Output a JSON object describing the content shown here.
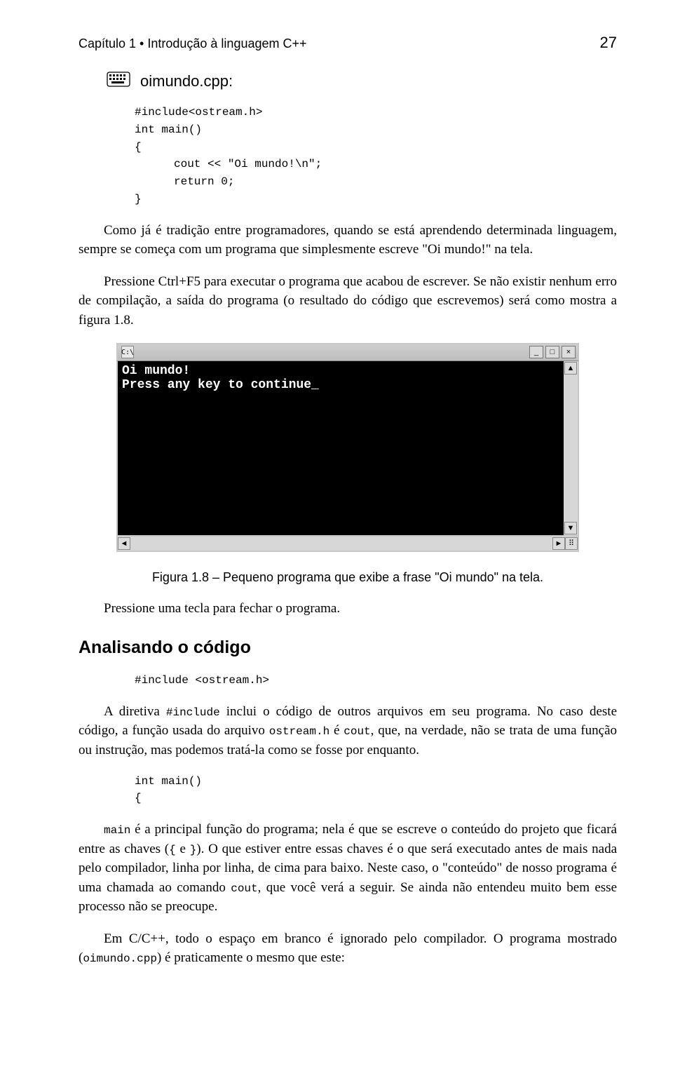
{
  "header": {
    "chapter": "Capítulo 1 • Introdução à linguagem C++",
    "pageNumber": "27"
  },
  "file": {
    "icon": "keyboard-icon",
    "name": "oimundo.cpp:"
  },
  "code1": {
    "l1": "#include<ostream.h>",
    "l2": "int main()",
    "l3": "{",
    "l4": "cout << \"Oi mundo!\\n\";",
    "l5": "return 0;",
    "l6": "}"
  },
  "para1": "Como já é tradição entre programadores, quando se está aprendendo determinada linguagem, sempre se começa com um programa que simplesmente escreve \"Oi mundo!\" na tela.",
  "para2": "Pressione Ctrl+F5 para executar o programa que acabou de escrever. Se não existir nenhum erro de compilação, a saída do programa (o resultado do código que escrevemos) será como mostra a figura 1.8.",
  "console": {
    "titleIcon": "C:\\",
    "minimize": "_",
    "maximize": "□",
    "close": "×",
    "line1": "Oi mundo!",
    "line2": "Press any key to continue_",
    "scrollUp": "▲",
    "scrollDown": "▼",
    "scrollLeft": "◄",
    "scrollRight": "►",
    "grip": "⠿"
  },
  "caption": "Figura 1.8 – Pequeno programa que exibe a frase \"Oi mundo\" na tela.",
  "para3": "Pressione uma tecla para fechar o programa.",
  "section": {
    "title": "Analisando o código"
  },
  "code2": {
    "l1": "#include <ostream.h>"
  },
  "para4_a": "A diretiva ",
  "para4_code1": "#include",
  "para4_b": " inclui o código de outros arquivos em seu programa. No caso deste código, a função usada do arquivo ",
  "para4_code2": "ostream.h",
  "para4_c": " é ",
  "para4_code3": "cout",
  "para4_d": ", que, na verdade, não se trata de uma função ou instrução, mas podemos tratá-la como se fosse por enquanto.",
  "code3": {
    "l1": "int main()",
    "l2": "{"
  },
  "para5_code1": "main",
  "para5_a": " é a principal função do programa; nela é que se escreve o conteúdo do projeto que ficará entre as chaves (",
  "para5_code2": "{",
  "para5_b": " e ",
  "para5_code3": "}",
  "para5_c": "). O que estiver entre essas chaves é o que será executado antes de mais nada pelo compilador, linha por linha, de cima para baixo. Neste caso, o \"conteúdo\" de nosso programa é uma chamada ao comando ",
  "para5_code4": "cout",
  "para5_d": ", que você verá a seguir. Se ainda não entendeu muito bem esse processo não se preocupe.",
  "para6_a": "Em C/C++, todo o espaço em branco é ignorado pelo compilador. O programa mostrado (",
  "para6_code1": "oimundo.cpp",
  "para6_b": ") é praticamente o mesmo que este:"
}
